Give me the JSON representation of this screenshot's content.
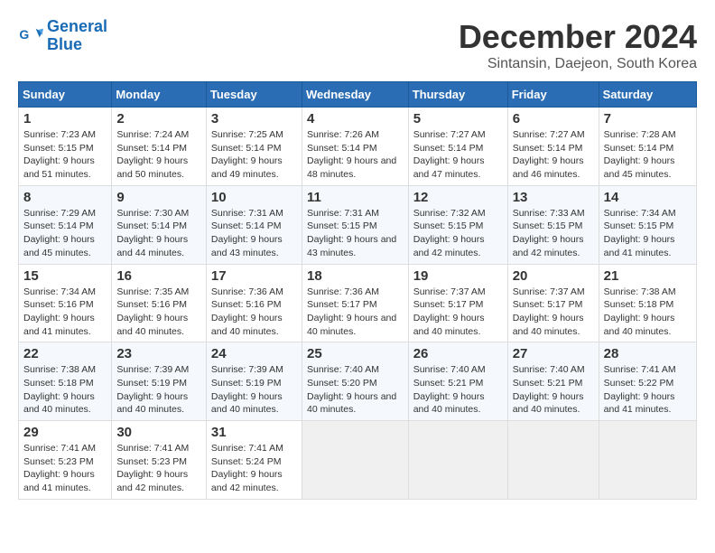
{
  "header": {
    "logo_line1": "General",
    "logo_line2": "Blue",
    "title": "December 2024",
    "subtitle": "Sintansin, Daejeon, South Korea"
  },
  "days_of_week": [
    "Sunday",
    "Monday",
    "Tuesday",
    "Wednesday",
    "Thursday",
    "Friday",
    "Saturday"
  ],
  "weeks": [
    [
      {
        "day": "1",
        "sunrise": "7:23 AM",
        "sunset": "5:15 PM",
        "daylight": "9 hours and 51 minutes."
      },
      {
        "day": "2",
        "sunrise": "7:24 AM",
        "sunset": "5:14 PM",
        "daylight": "9 hours and 50 minutes."
      },
      {
        "day": "3",
        "sunrise": "7:25 AM",
        "sunset": "5:14 PM",
        "daylight": "9 hours and 49 minutes."
      },
      {
        "day": "4",
        "sunrise": "7:26 AM",
        "sunset": "5:14 PM",
        "daylight": "9 hours and 48 minutes."
      },
      {
        "day": "5",
        "sunrise": "7:27 AM",
        "sunset": "5:14 PM",
        "daylight": "9 hours and 47 minutes."
      },
      {
        "day": "6",
        "sunrise": "7:27 AM",
        "sunset": "5:14 PM",
        "daylight": "9 hours and 46 minutes."
      },
      {
        "day": "7",
        "sunrise": "7:28 AM",
        "sunset": "5:14 PM",
        "daylight": "9 hours and 45 minutes."
      }
    ],
    [
      {
        "day": "8",
        "sunrise": "7:29 AM",
        "sunset": "5:14 PM",
        "daylight": "9 hours and 45 minutes."
      },
      {
        "day": "9",
        "sunrise": "7:30 AM",
        "sunset": "5:14 PM",
        "daylight": "9 hours and 44 minutes."
      },
      {
        "day": "10",
        "sunrise": "7:31 AM",
        "sunset": "5:14 PM",
        "daylight": "9 hours and 43 minutes."
      },
      {
        "day": "11",
        "sunrise": "7:31 AM",
        "sunset": "5:15 PM",
        "daylight": "9 hours and 43 minutes."
      },
      {
        "day": "12",
        "sunrise": "7:32 AM",
        "sunset": "5:15 PM",
        "daylight": "9 hours and 42 minutes."
      },
      {
        "day": "13",
        "sunrise": "7:33 AM",
        "sunset": "5:15 PM",
        "daylight": "9 hours and 42 minutes."
      },
      {
        "day": "14",
        "sunrise": "7:34 AM",
        "sunset": "5:15 PM",
        "daylight": "9 hours and 41 minutes."
      }
    ],
    [
      {
        "day": "15",
        "sunrise": "7:34 AM",
        "sunset": "5:16 PM",
        "daylight": "9 hours and 41 minutes."
      },
      {
        "day": "16",
        "sunrise": "7:35 AM",
        "sunset": "5:16 PM",
        "daylight": "9 hours and 40 minutes."
      },
      {
        "day": "17",
        "sunrise": "7:36 AM",
        "sunset": "5:16 PM",
        "daylight": "9 hours and 40 minutes."
      },
      {
        "day": "18",
        "sunrise": "7:36 AM",
        "sunset": "5:17 PM",
        "daylight": "9 hours and 40 minutes."
      },
      {
        "day": "19",
        "sunrise": "7:37 AM",
        "sunset": "5:17 PM",
        "daylight": "9 hours and 40 minutes."
      },
      {
        "day": "20",
        "sunrise": "7:37 AM",
        "sunset": "5:17 PM",
        "daylight": "9 hours and 40 minutes."
      },
      {
        "day": "21",
        "sunrise": "7:38 AM",
        "sunset": "5:18 PM",
        "daylight": "9 hours and 40 minutes."
      }
    ],
    [
      {
        "day": "22",
        "sunrise": "7:38 AM",
        "sunset": "5:18 PM",
        "daylight": "9 hours and 40 minutes."
      },
      {
        "day": "23",
        "sunrise": "7:39 AM",
        "sunset": "5:19 PM",
        "daylight": "9 hours and 40 minutes."
      },
      {
        "day": "24",
        "sunrise": "7:39 AM",
        "sunset": "5:19 PM",
        "daylight": "9 hours and 40 minutes."
      },
      {
        "day": "25",
        "sunrise": "7:40 AM",
        "sunset": "5:20 PM",
        "daylight": "9 hours and 40 minutes."
      },
      {
        "day": "26",
        "sunrise": "7:40 AM",
        "sunset": "5:21 PM",
        "daylight": "9 hours and 40 minutes."
      },
      {
        "day": "27",
        "sunrise": "7:40 AM",
        "sunset": "5:21 PM",
        "daylight": "9 hours and 40 minutes."
      },
      {
        "day": "28",
        "sunrise": "7:41 AM",
        "sunset": "5:22 PM",
        "daylight": "9 hours and 41 minutes."
      }
    ],
    [
      {
        "day": "29",
        "sunrise": "7:41 AM",
        "sunset": "5:23 PM",
        "daylight": "9 hours and 41 minutes."
      },
      {
        "day": "30",
        "sunrise": "7:41 AM",
        "sunset": "5:23 PM",
        "daylight": "9 hours and 42 minutes."
      },
      {
        "day": "31",
        "sunrise": "7:41 AM",
        "sunset": "5:24 PM",
        "daylight": "9 hours and 42 minutes."
      },
      null,
      null,
      null,
      null
    ]
  ],
  "labels": {
    "sunrise": "Sunrise:",
    "sunset": "Sunset:",
    "daylight": "Daylight:"
  }
}
